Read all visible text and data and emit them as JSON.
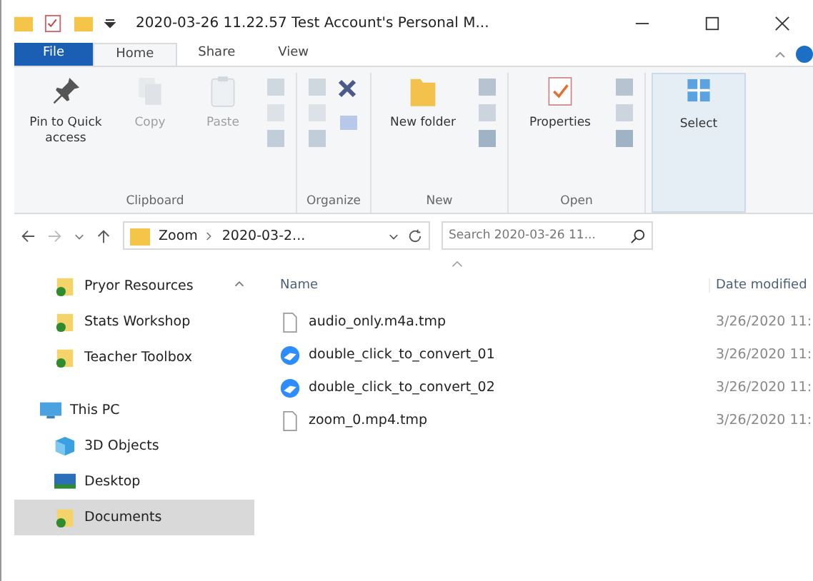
{
  "window": {
    "title": "2020-03-26 11.22.57 Test Account's Personal M..."
  },
  "tabs": [
    {
      "label": "File",
      "kind": "file",
      "selected": false
    },
    {
      "label": "Home",
      "kind": "tab",
      "selected": true
    },
    {
      "label": "Share",
      "kind": "tab",
      "selected": false
    },
    {
      "label": "View",
      "kind": "tab",
      "selected": false
    }
  ],
  "ribbon": [
    {
      "group": "Clipboard",
      "buttons": [
        {
          "label": "Pin to Quick access",
          "kind": "pin",
          "disabled": false
        },
        {
          "label": "Copy",
          "kind": "copy",
          "disabled": true
        },
        {
          "label": "Paste",
          "kind": "paste",
          "disabled": true
        },
        {
          "kind": "small",
          "disabled": true
        }
      ]
    },
    {
      "group": "Organize",
      "buttons": [
        {
          "kind": "move",
          "disabled": true
        },
        {
          "kind": "delete",
          "disabled": false
        }
      ]
    },
    {
      "group": "New",
      "buttons": [
        {
          "label": "New folder",
          "kind": "folder",
          "disabled": false
        },
        {
          "kind": "newitem",
          "disabled": false
        }
      ]
    },
    {
      "group": "Open",
      "buttons": [
        {
          "label": "Properties",
          "kind": "properties",
          "disabled": false
        },
        {
          "kind": "openitems",
          "disabled": false
        }
      ]
    },
    {
      "buttons": [
        {
          "label": "Select",
          "kind": "select",
          "disabled": false
        }
      ]
    }
  ],
  "address": {
    "path": [
      "Zoom",
      "2020-03-2..."
    ],
    "search_placeholder": "Search 2020-03-26 11..."
  },
  "sidebar": {
    "items": [
      {
        "label": "Pryor Resources",
        "kind": "folder",
        "selected": false
      },
      {
        "label": "Stats Workshop",
        "kind": "folder",
        "selected": false
      },
      {
        "label": "Teacher Toolbox",
        "kind": "folder",
        "selected": false
      },
      {
        "label": "This PC",
        "kind": "pc",
        "selected": false
      },
      {
        "label": "3D Objects",
        "kind": "objects",
        "selected": false
      },
      {
        "label": "Desktop",
        "kind": "desktop",
        "selected": false
      },
      {
        "label": "Documents",
        "kind": "folder",
        "selected": true
      }
    ]
  },
  "table": {
    "columns": [
      "Name",
      "Date modified"
    ],
    "rows": [
      {
        "name": "audio_only.m4a.tmp",
        "kind": "file",
        "date": "3/26/2020 11:"
      },
      {
        "name": "double_click_to_convert_01",
        "kind": "zoom",
        "date": "3/26/2020 11:"
      },
      {
        "name": "double_click_to_convert_02",
        "kind": "zoom",
        "date": "3/26/2020 11:"
      },
      {
        "name": "zoom_0.mp4.tmp",
        "kind": "file",
        "date": "3/26/2020 11:"
      }
    ]
  }
}
